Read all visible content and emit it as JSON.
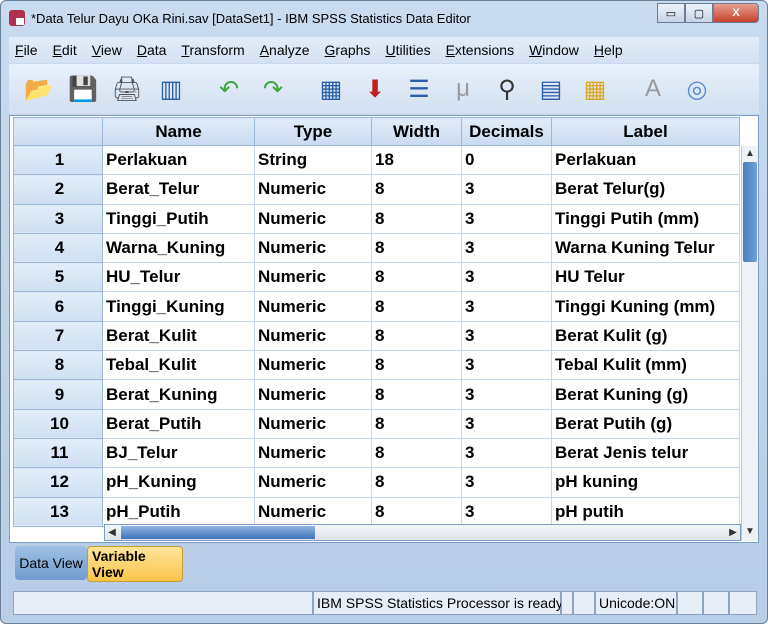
{
  "window": {
    "title": "*Data Telur Dayu OKa Rini.sav [DataSet1] - IBM SPSS Statistics Data Editor",
    "minimize": "▭",
    "maximize": "▢",
    "close": "X"
  },
  "menu": [
    "File",
    "Edit",
    "View",
    "Data",
    "Transform",
    "Analyze",
    "Graphs",
    "Utilities",
    "Extensions",
    "Window",
    "Help"
  ],
  "toolbar": [
    {
      "icon": "open-folder-icon",
      "glyph": "📂"
    },
    {
      "icon": "save-icon",
      "glyph": "💾"
    },
    {
      "icon": "print-icon",
      "glyph": "🖨"
    },
    {
      "icon": "recall-dialog-icon",
      "glyph": "▥"
    },
    {
      "icon": "undo-icon",
      "glyph": "↶"
    },
    {
      "icon": "redo-icon",
      "glyph": "↷"
    },
    {
      "icon": "go-to-case-icon",
      "glyph": "▦"
    },
    {
      "icon": "go-to-variable-icon",
      "glyph": "⬇"
    },
    {
      "icon": "variables-icon",
      "glyph": "☰"
    },
    {
      "icon": "run-descriptives-icon",
      "glyph": "μ"
    },
    {
      "icon": "find-icon",
      "glyph": "⚲"
    },
    {
      "icon": "insert-cases-icon",
      "glyph": "▤"
    },
    {
      "icon": "insert-variable-icon",
      "glyph": "▦"
    },
    {
      "icon": "value-labels-icon",
      "glyph": "A"
    },
    {
      "icon": "use-sets-icon",
      "glyph": "◎"
    }
  ],
  "grid": {
    "columns": [
      "Name",
      "Type",
      "Width",
      "Decimals",
      "Label"
    ],
    "rows": [
      [
        "1",
        "Perlakuan",
        "String",
        "18",
        "0",
        "Perlakuan"
      ],
      [
        "2",
        "Berat_Telur",
        "Numeric",
        "8",
        "3",
        "Berat Telur(g)"
      ],
      [
        "3",
        "Tinggi_Putih",
        "Numeric",
        "8",
        "3",
        "Tinggi Putih (mm)"
      ],
      [
        "4",
        "Warna_Kuning",
        "Numeric",
        "8",
        "3",
        "Warna Kuning Telur"
      ],
      [
        "5",
        "HU_Telur",
        "Numeric",
        "8",
        "3",
        "HU Telur"
      ],
      [
        "6",
        "Tinggi_Kuning",
        "Numeric",
        "8",
        "3",
        "Tinggi Kuning (mm)"
      ],
      [
        "7",
        "Berat_Kulit",
        "Numeric",
        "8",
        "3",
        "Berat Kulit (g)"
      ],
      [
        "8",
        "Tebal_Kulit",
        "Numeric",
        "8",
        "3",
        "Tebal Kulit (mm)"
      ],
      [
        "9",
        "Berat_Kuning",
        "Numeric",
        "8",
        "3",
        "Berat Kuning (g)"
      ],
      [
        "10",
        "Berat_Putih",
        "Numeric",
        "8",
        "3",
        "Berat Putih (g)"
      ],
      [
        "11",
        "BJ_Telur",
        "Numeric",
        "8",
        "3",
        "Berat Jenis telur"
      ],
      [
        "12",
        "pH_Kuning",
        "Numeric",
        "8",
        "3",
        "pH kuning"
      ],
      [
        "13",
        "pH_Putih",
        "Numeric",
        "8",
        "3",
        "pH putih"
      ]
    ]
  },
  "tabs": {
    "data_view": "Data View",
    "variable_view": "Variable View"
  },
  "status": {
    "processor": "IBM SPSS Statistics Processor is ready",
    "unicode": "Unicode:ON"
  }
}
